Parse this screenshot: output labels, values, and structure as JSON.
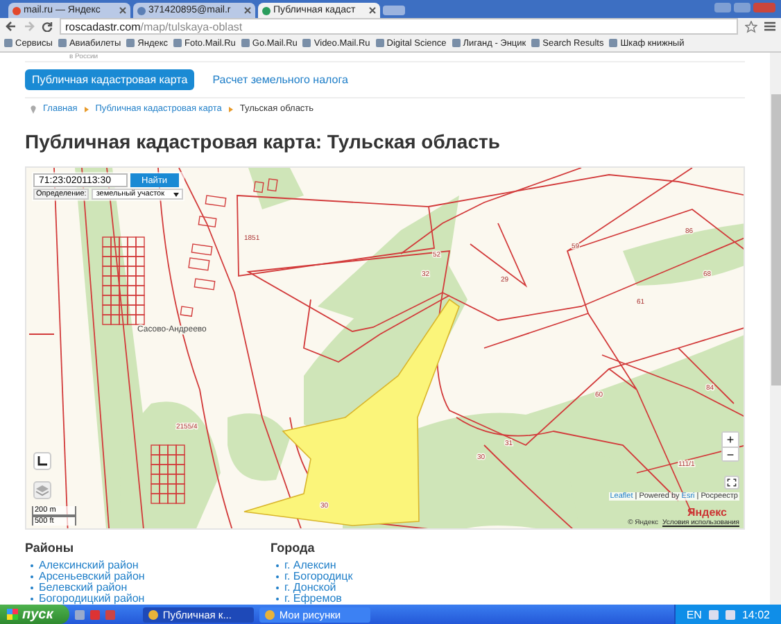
{
  "browser": {
    "tabs": [
      {
        "label": "mail.ru — Яндекс",
        "selected": false
      },
      {
        "label": "371420895@mail.r",
        "selected": false
      },
      {
        "label": "Публичная кадаст",
        "selected": true
      }
    ],
    "url": {
      "host": "roscadastr.com",
      "path": "/map/tulskaya-oblast"
    },
    "bookmarks": [
      "Сервисы",
      "Авиабилеты",
      "Яндекс",
      "Foto.Mail.Ru",
      "Go.Mail.Ru",
      "Video.Mail.Ru",
      "Digital Science",
      "Лиганд - Энцик",
      "Search Results",
      "Шкаф книжный"
    ]
  },
  "page": {
    "header_note": "в России",
    "nav": [
      {
        "label": "Публичная кадастровая карта",
        "selected": true
      },
      {
        "label": "Расчет земельного налога",
        "selected": false
      }
    ],
    "breadcrumbs": [
      "Главная",
      "Публичная кадастровая карта",
      "Тульская область"
    ],
    "title": "Публичная кадастровая карта: Тульская область",
    "map": {
      "search_value": "71:23:020113:30",
      "search_button": "Найти",
      "mode_label": "Определение:",
      "mode_value": "земельный участок",
      "place_label": "Сасово-Андреево",
      "parcel_labels": [
        "1851",
        "52",
        "32",
        "59",
        "86",
        "29",
        "68",
        "61",
        "2155/4",
        "30",
        "30",
        "31",
        "111/1",
        "84",
        "60"
      ],
      "zoom_in": "+",
      "zoom_out": "−",
      "scale": [
        "200 m",
        "500 ft"
      ],
      "attribution": [
        {
          "text": "Leaflet",
          "link": true
        },
        {
          "text": " | Powered by ",
          "link": false
        },
        {
          "text": "Esri",
          "link": true
        },
        {
          "text": " | Росреестр",
          "link": false
        }
      ],
      "provider": "Яндекс",
      "copyright": "© Яндекс",
      "terms": "Условия использования"
    },
    "lists": [
      {
        "heading": "Районы",
        "items": [
          "Алексинский район",
          "Арсеньевский район",
          "Белевский район",
          "Богородицкий район"
        ]
      },
      {
        "heading": "Города",
        "items": [
          "г. Алексин",
          "г. Богородицк",
          "г. Донской",
          "г. Ефремов"
        ]
      }
    ]
  },
  "taskbar": {
    "start": "пуск",
    "tasks": [
      {
        "label": "Публичная к...",
        "selected": true
      },
      {
        "label": "Мои рисунки",
        "selected": false
      }
    ],
    "language": "EN",
    "clock": "14:02"
  }
}
